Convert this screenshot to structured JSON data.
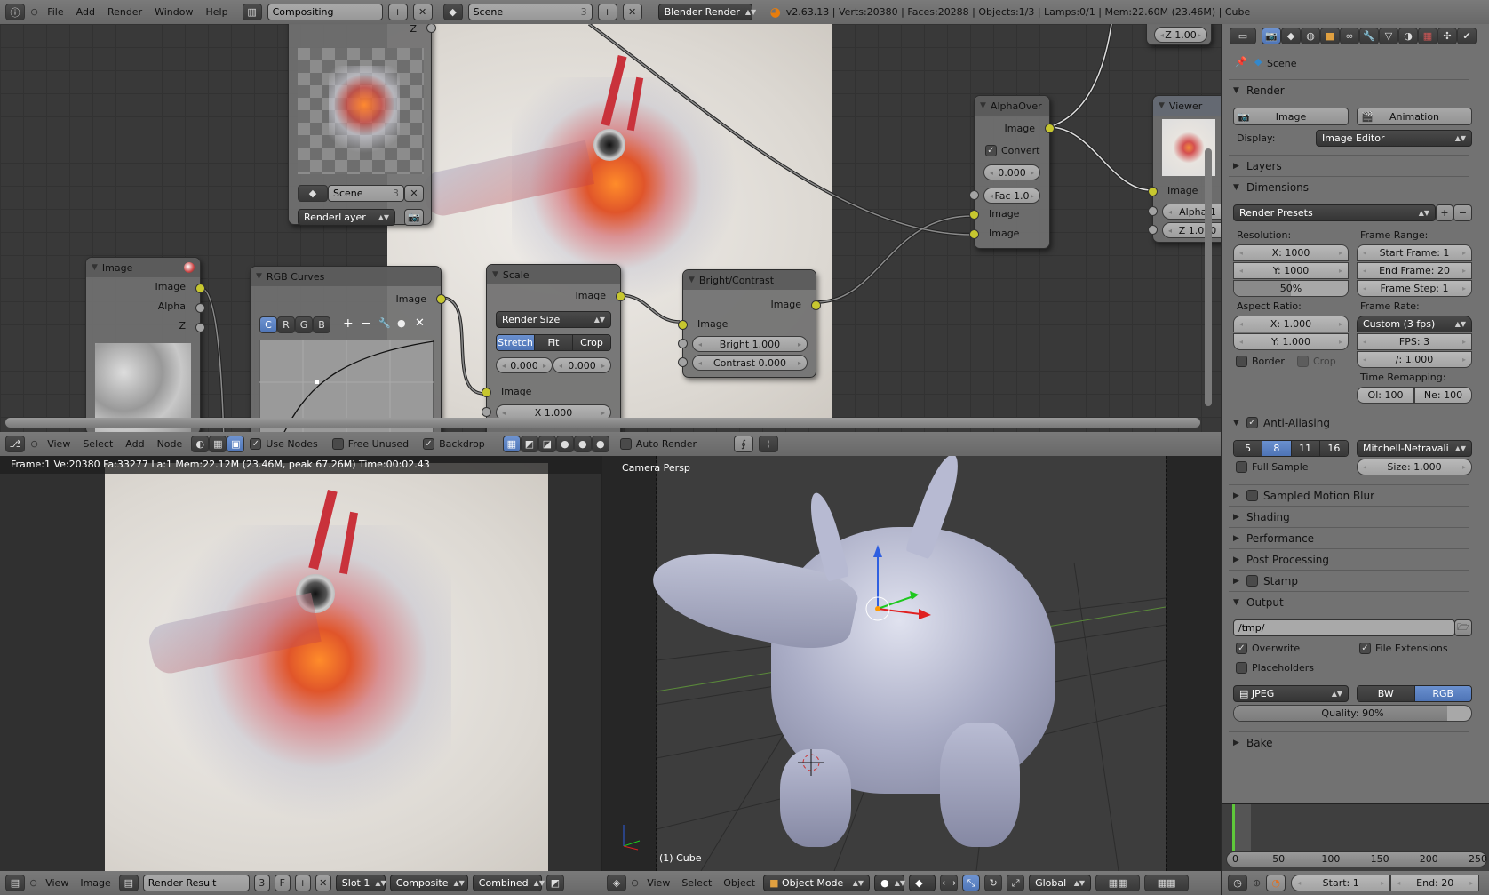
{
  "top_header": {
    "menus": [
      "File",
      "Add",
      "Render",
      "Window",
      "Help"
    ],
    "screen_layout": "Compositing",
    "scene": "Scene",
    "scene_users": "3",
    "render_engine": "Blender Render",
    "stats": "v2.63.13 | Verts:20380 | Faces:20288 | Objects:1/3 | Lamps:0/1 | Mem:22.60M (23.46M) | Cube"
  },
  "node_editor": {
    "render_layers": {
      "scene": "Scene",
      "scene_users": "3",
      "layer": "RenderLayer",
      "z_label": "Z"
    },
    "image_node": {
      "title": "Image",
      "outputs": [
        "Image",
        "Alpha",
        "Z"
      ]
    },
    "rgb_curves": {
      "title": "RGB Curves",
      "output": "Image",
      "channels": [
        "C",
        "R",
        "G",
        "B"
      ],
      "active_channel": "C"
    },
    "scale": {
      "title": "Scale",
      "output": "Image",
      "mode": "Render Size",
      "fit_options": [
        "Stretch",
        "Fit",
        "Crop"
      ],
      "active_fit": "Stretch",
      "offset_x": "0.000",
      "offset_y": "0.000",
      "input": "Image",
      "x": "X 1.000"
    },
    "bright_contrast": {
      "title": "Bright/Contrast",
      "output": "Image",
      "input": "Image",
      "bright": "Bright 1.000",
      "contrast": "Contrast 0.000"
    },
    "alpha_over": {
      "title": "AlphaOver",
      "output": "Image",
      "convert_label": "Convert",
      "convert_checked": true,
      "premul": "0.000",
      "fac": "Fac 1.0",
      "inputs": [
        "Image",
        "Image"
      ]
    },
    "viewer": {
      "title": "Viewer",
      "input": "Image",
      "alpha": "Alpha 1",
      "z": "Z 1.000"
    },
    "offscreen_z": "Z 1.00"
  },
  "node_header": {
    "menus": [
      "View",
      "Select",
      "Add",
      "Node"
    ],
    "use_nodes": {
      "label": "Use Nodes",
      "checked": true
    },
    "free_unused": {
      "label": "Free Unused",
      "checked": false
    },
    "backdrop": {
      "label": "Backdrop",
      "checked": true
    },
    "auto_render": {
      "label": "Auto Render",
      "checked": false
    }
  },
  "image_editor": {
    "render_info": "Frame:1 Ve:20380 Fa:33277 La:1 Mem:22.12M (23.46M, peak 67.26M) Time:00:02.43",
    "header": {
      "menus": [
        "View",
        "Image"
      ],
      "image": "Render Result",
      "users": "3",
      "fake": "F",
      "slot": "Slot 1",
      "layer": "Composite",
      "pass": "Combined"
    }
  },
  "viewport": {
    "view_name": "Camera Persp",
    "object_label": "(1) Cube",
    "header": {
      "menus": [
        "View",
        "Select",
        "Object"
      ],
      "mode": "Object Mode",
      "orientation": "Global"
    }
  },
  "properties": {
    "context": "Scene",
    "render": {
      "title": "Render",
      "image_btn": "Image",
      "animation_btn": "Animation",
      "display_label": "Display:",
      "display_value": "Image Editor"
    },
    "layers": "Layers",
    "dimensions": {
      "title": "Dimensions",
      "presets": "Render Presets",
      "resolution_label": "Resolution:",
      "res_x": "X: 1000",
      "res_y": "Y: 1000",
      "res_percent": "50%",
      "res_percent_value": 50,
      "frame_range_label": "Frame Range:",
      "start": "Start Frame: 1",
      "end": "End Frame: 20",
      "step": "Frame Step: 1",
      "aspect_label": "Aspect Ratio:",
      "asp_x": "X: 1.000",
      "asp_y": "Y: 1.000",
      "frame_rate_label": "Frame Rate:",
      "frame_rate": "Custom (3 fps)",
      "fps": "FPS: 3",
      "base": "/: 1.000",
      "border": "Border",
      "crop": "Crop",
      "time_remap_label": "Time Remapping:",
      "old": "Ol: 100",
      "new": "Ne: 100"
    },
    "anti_aliasing": {
      "title": "Anti-Aliasing",
      "enabled": true,
      "samples": [
        "5",
        "8",
        "11",
        "16"
      ],
      "active": "8",
      "filter": "Mitchell-Netravali",
      "full_sample": "Full Sample",
      "size": "Size: 1.000"
    },
    "collapsed_panels": {
      "motion_blur": "Sampled Motion Blur",
      "shading": "Shading",
      "performance": "Performance",
      "post_processing": "Post Processing",
      "stamp": "Stamp",
      "bake": "Bake"
    },
    "output": {
      "title": "Output",
      "path": "/tmp/",
      "overwrite": "Overwrite",
      "file_extensions": "File Extensions",
      "placeholders": "Placeholders",
      "format": "JPEG",
      "color_modes": [
        "BW",
        "RGB"
      ],
      "active_color": "RGB",
      "quality": "Quality: 90%",
      "quality_value": 90
    }
  },
  "timeline": {
    "ticks": [
      "0",
      "50",
      "100",
      "150",
      "200",
      "250"
    ],
    "current_frame": 1,
    "start": "Start: 1",
    "end": "End: 20"
  },
  "colors": {
    "accent_blue": "#5a80c2",
    "socket_yellow": "#c7c72f",
    "frame_marker": "#5ec83a"
  }
}
